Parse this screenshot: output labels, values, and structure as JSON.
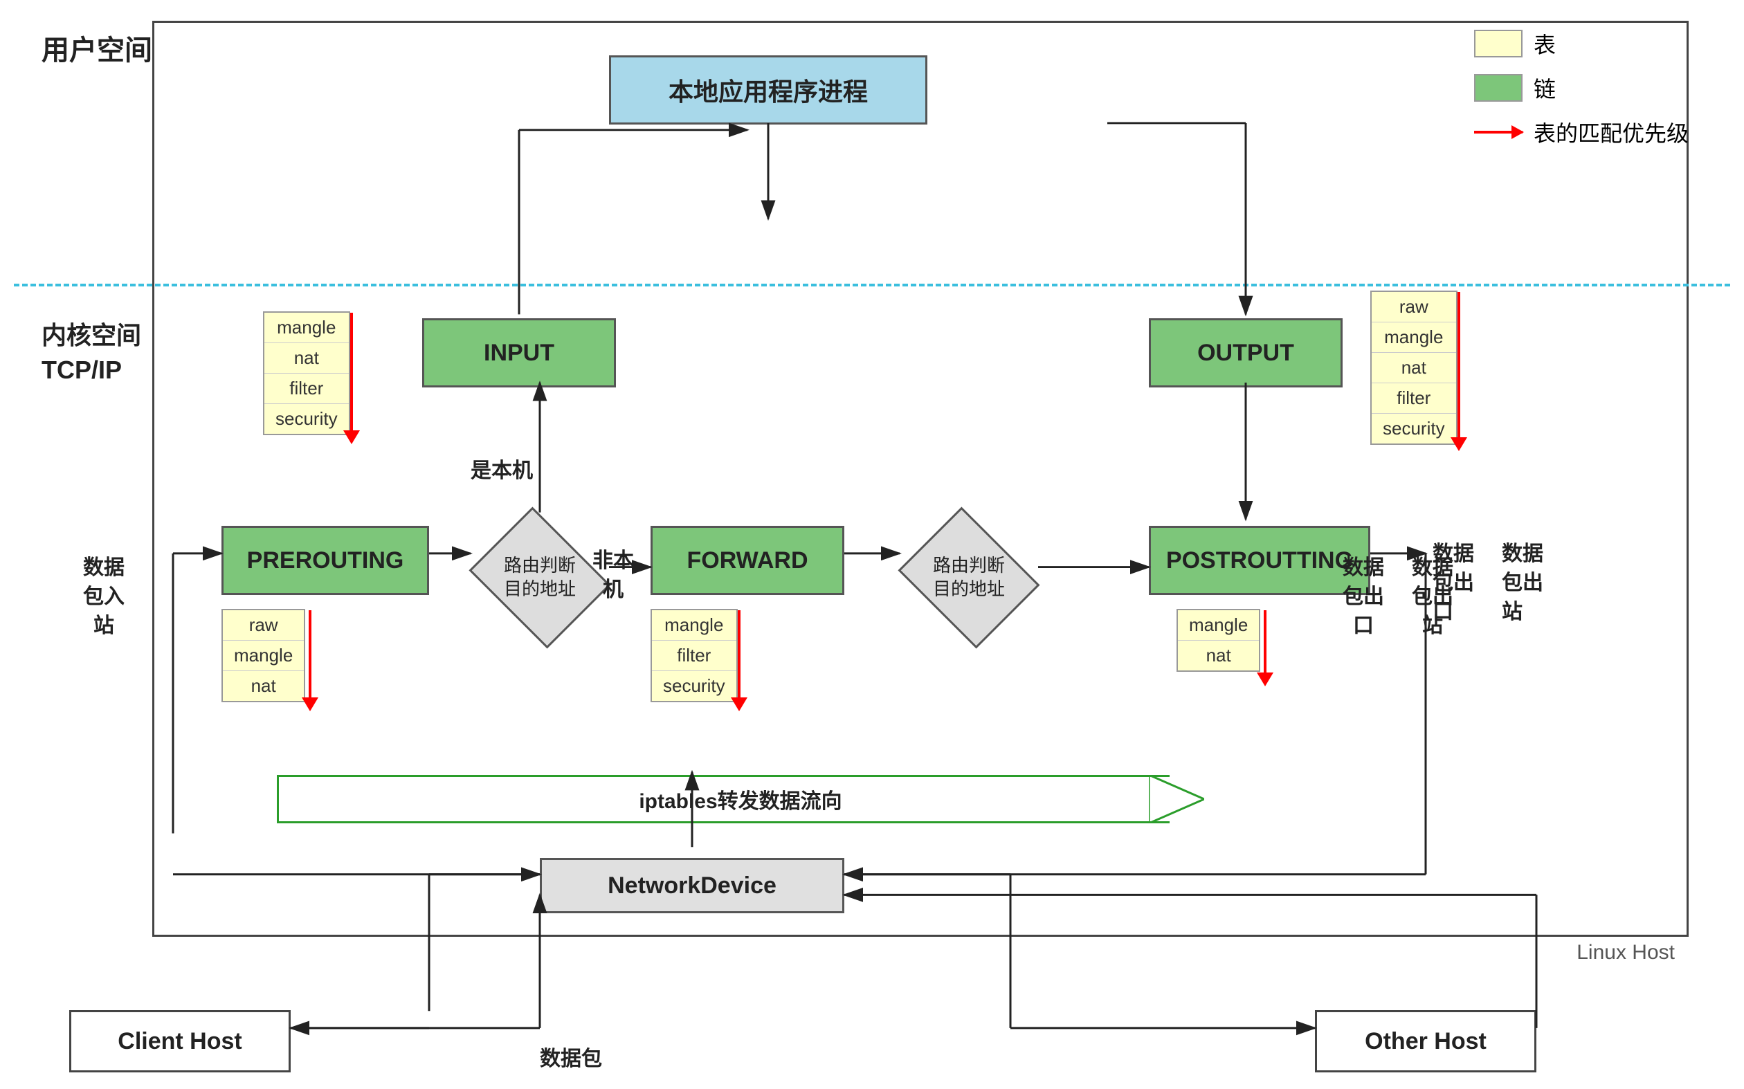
{
  "labels": {
    "userspace": "用户空间",
    "kernelspace": "内核空间\nTCP/IP",
    "kernelspace_line1": "内核空间",
    "kernelspace_line2": "TCP/IP",
    "local_process": "本地应用程序进程",
    "input_chain": "INPUT",
    "output_chain": "OUTPUT",
    "prerouting_chain": "PREROUTING",
    "forward_chain": "FORWARD",
    "postrouting_chain": "POSTROUTTING",
    "routing1_label_line1": "路由判断",
    "routing1_label_line2": "目的地址",
    "routing2_label_line1": "路由判断",
    "routing2_label_line2": "目的地址",
    "is_local": "是本机",
    "not_local_line1": "非本",
    "not_local_line2": "机",
    "iptables_forward": "iptables转发数据流向",
    "network_device": "NetworkDevice",
    "client_host": "Client Host",
    "other_host": "Other Host",
    "linux_host": "Linux Host",
    "data_in_line1": "数据",
    "data_in_line2": "包入",
    "data_in_line3": "站",
    "data_out_line1": "数据",
    "data_out_line2": "包出",
    "data_out_line3": "口",
    "data_out2_line1": "数据",
    "data_out2_line2": "包出",
    "data_out2_line3": "站",
    "packet_label": "数据包"
  },
  "legend": {
    "table_label": "表",
    "chain_label": "链",
    "priority_label": "表的匹配优先级"
  },
  "input_tables": [
    "mangle",
    "nat",
    "filter",
    "security"
  ],
  "output_tables": [
    "raw",
    "mangle",
    "nat",
    "filter",
    "security"
  ],
  "prerouting_tables": [
    "raw",
    "mangle",
    "nat"
  ],
  "forward_tables": [
    "mangle",
    "filter",
    "security"
  ],
  "postrouting_tables": [
    "mangle",
    "nat"
  ]
}
